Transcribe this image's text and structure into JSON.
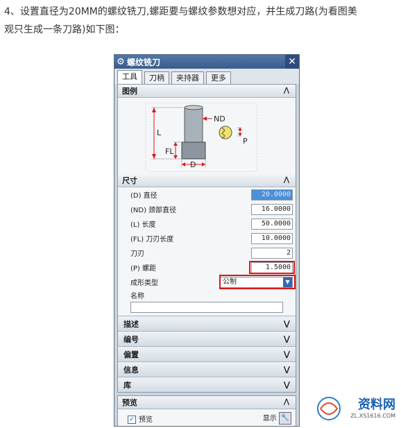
{
  "intro": {
    "line1": "4、设置直径为20MM的螺纹铣刀,螺距要与螺纹参数想对应，并生成刀路(为看图美",
    "line2": "观只生成一条刀路)如下图："
  },
  "dialog": {
    "title": "螺纹铣刀",
    "close": "✕",
    "tabs": [
      "工具",
      "刀柄",
      "夹持器",
      "更多"
    ],
    "legend_section": "图例",
    "figure_labels": {
      "nd": "ND",
      "l": "L",
      "fl": "FL",
      "d": "D",
      "p": "P"
    },
    "dims_section": "尺寸",
    "fields": [
      {
        "label": "(D) 直径",
        "value": "20.0000"
      },
      {
        "label": "(ND) 颈部直径",
        "value": "16.0000"
      },
      {
        "label": "(L) 长度",
        "value": "50.0000"
      },
      {
        "label": "(FL) 刀刃长度",
        "value": "10.0000"
      },
      {
        "label": "刀刃",
        "value": "2"
      },
      {
        "label": "(P) 螺距",
        "value": "1.5000"
      }
    ],
    "form_type_label": "成形类型",
    "form_type_value": "公制",
    "name_label": "名称",
    "name_value": "",
    "collapsed_sections": [
      "描述",
      "编号",
      "偏置",
      "信息",
      "库"
    ],
    "preview_section": "预览",
    "preview_checkbox": "预览",
    "show_label": "显示"
  },
  "watermark": {
    "text": "资料网",
    "url": "ZL.XS1616.COM"
  },
  "colors": {
    "title_bar": "#3a5c8c",
    "highlight_red": "#d81818",
    "selected_field": "#4d8fd8"
  }
}
